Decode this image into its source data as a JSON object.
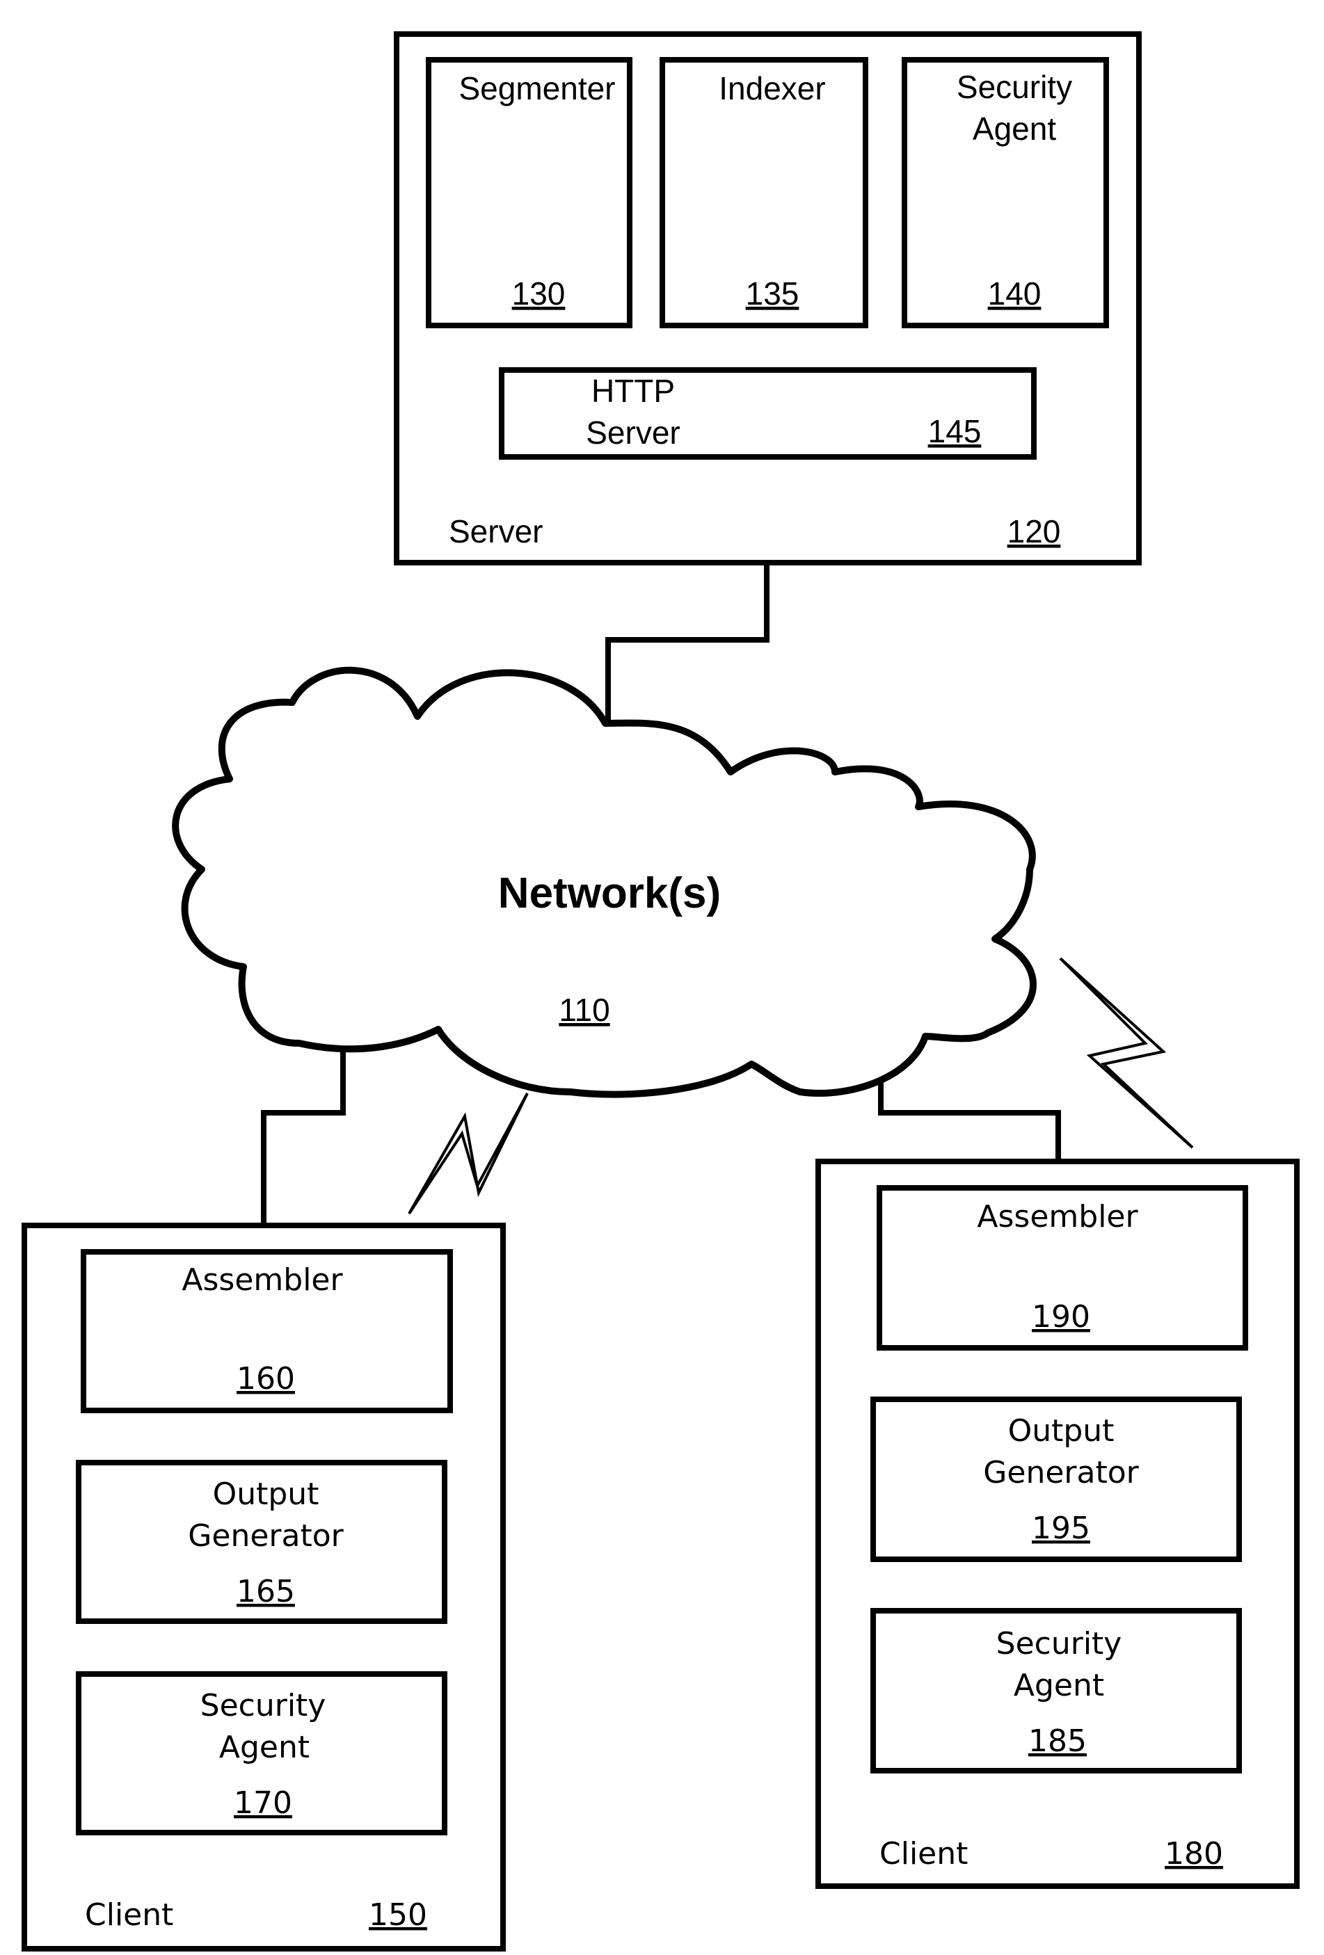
{
  "diagram": {
    "server": {
      "label": "Server",
      "ref": "120",
      "components": [
        {
          "line1": "Segmenter",
          "line2": "",
          "ref": "130"
        },
        {
          "line1": "Indexer",
          "line2": "",
          "ref": "135"
        },
        {
          "line1": "Security",
          "line2": "Agent",
          "ref": "140"
        }
      ],
      "http": {
        "line1": "HTTP",
        "line2": "Server",
        "ref": "145"
      }
    },
    "network": {
      "label": "Network(s)",
      "ref": "110"
    },
    "client_left": {
      "label": "Client",
      "ref": "150",
      "components": [
        {
          "line1": "Assembler",
          "line2": "",
          "ref": "160"
        },
        {
          "line1": "Output",
          "line2": "Generator",
          "ref": "165"
        },
        {
          "line1": "Security",
          "line2": "Agent",
          "ref": "170"
        }
      ]
    },
    "client_right": {
      "label": "Client",
      "ref": "180",
      "components": [
        {
          "line1": "Assembler",
          "line2": "",
          "ref": "190"
        },
        {
          "line1": "Output",
          "line2": "Generator",
          "ref": "195"
        },
        {
          "line1": "Security",
          "line2": "Agent",
          "ref": "185"
        }
      ]
    }
  }
}
